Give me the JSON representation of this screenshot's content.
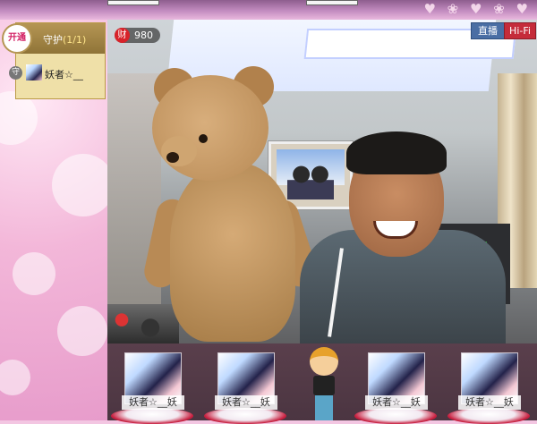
{
  "top_strip": {
    "decor": "♥ ❀ ♥ ❀ ♥"
  },
  "guard_panel": {
    "open_label": "开通",
    "title": "守护",
    "count": "(1/1)",
    "member": {
      "mark": "守",
      "name": "妖者☆__"
    }
  },
  "video": {
    "wealth_icon_label": "财",
    "wealth_value": "980",
    "live_label": "直播",
    "hifi_label": "Hi-Fi"
  },
  "seats": [
    {
      "label": "妖者☆__妖"
    },
    {
      "label": "妖者☆__妖"
    },
    {
      "label": "妖者☆__妖"
    },
    {
      "label": "妖者☆__妖"
    }
  ],
  "colors": {
    "accent_red": "#c52c3a",
    "live_blue": "#4a6ea4",
    "panel_pink": "#f3c6e2",
    "guard_gold": "#b59654"
  }
}
